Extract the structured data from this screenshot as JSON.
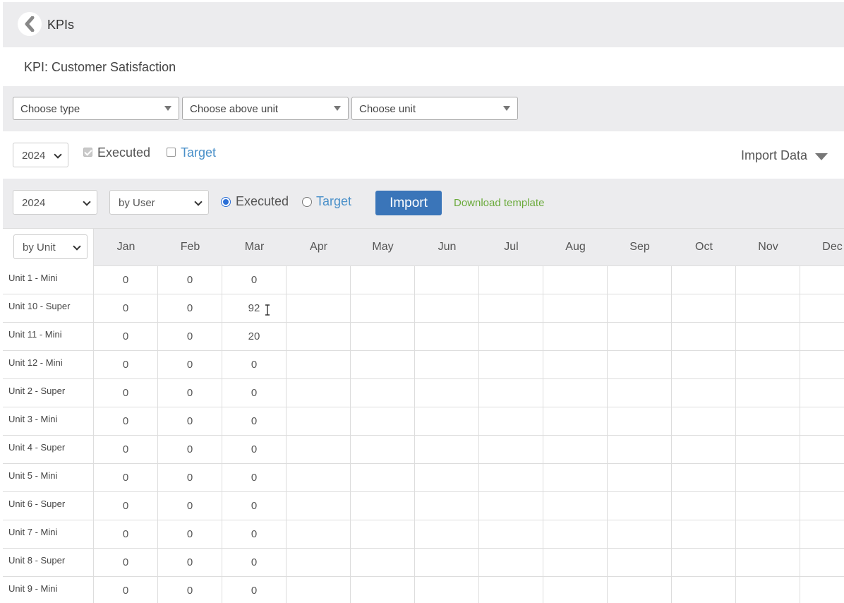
{
  "topbar": {
    "title": "KPIs"
  },
  "kpi": {
    "title": "KPI: Customer Satisfaction"
  },
  "filters": {
    "type": "Choose type",
    "above_unit": "Choose above unit",
    "unit": "Choose unit"
  },
  "view": {
    "year": "2024",
    "executed_label": "Executed",
    "executed_checked": true,
    "target_label": "Target",
    "target_checked": false,
    "import_data_label": "Import Data"
  },
  "import_bar": {
    "year": "2024",
    "by": "by User",
    "executed_label": "Executed",
    "target_label": "Target",
    "selected": "Executed",
    "import_button": "Import",
    "download_template": "Download template"
  },
  "grid": {
    "group_by": "by Unit",
    "months": [
      "Jan",
      "Feb",
      "Mar",
      "Apr",
      "May",
      "Jun",
      "Jul",
      "Aug",
      "Sep",
      "Oct",
      "Nov",
      "Dec"
    ],
    "rows": [
      {
        "unit": "Unit 1 - Mini",
        "values": [
          "0",
          "0",
          "0",
          "",
          "",
          "",
          "",
          "",
          "",
          "",
          "",
          ""
        ]
      },
      {
        "unit": "Unit 10 - Super",
        "values": [
          "0",
          "0",
          "92",
          "",
          "",
          "",
          "",
          "",
          "",
          "",
          "",
          ""
        ]
      },
      {
        "unit": "Unit 11 - Mini",
        "values": [
          "0",
          "0",
          "20",
          "",
          "",
          "",
          "",
          "",
          "",
          "",
          "",
          ""
        ]
      },
      {
        "unit": "Unit 12 - Mini",
        "values": [
          "0",
          "0",
          "0",
          "",
          "",
          "",
          "",
          "",
          "",
          "",
          "",
          ""
        ]
      },
      {
        "unit": "Unit 2 - Super",
        "values": [
          "0",
          "0",
          "0",
          "",
          "",
          "",
          "",
          "",
          "",
          "",
          "",
          ""
        ]
      },
      {
        "unit": "Unit 3 - Mini",
        "values": [
          "0",
          "0",
          "0",
          "",
          "",
          "",
          "",
          "",
          "",
          "",
          "",
          ""
        ]
      },
      {
        "unit": "Unit 4 - Super",
        "values": [
          "0",
          "0",
          "0",
          "",
          "",
          "",
          "",
          "",
          "",
          "",
          "",
          ""
        ]
      },
      {
        "unit": "Unit 5 - Mini",
        "values": [
          "0",
          "0",
          "0",
          "",
          "",
          "",
          "",
          "",
          "",
          "",
          "",
          ""
        ]
      },
      {
        "unit": "Unit 6 - Super",
        "values": [
          "0",
          "0",
          "0",
          "",
          "",
          "",
          "",
          "",
          "",
          "",
          "",
          ""
        ]
      },
      {
        "unit": "Unit 7 - Mini",
        "values": [
          "0",
          "0",
          "0",
          "",
          "",
          "",
          "",
          "",
          "",
          "",
          "",
          ""
        ]
      },
      {
        "unit": "Unit 8 - Super",
        "values": [
          "0",
          "0",
          "0",
          "",
          "",
          "",
          "",
          "",
          "",
          "",
          "",
          ""
        ]
      },
      {
        "unit": "Unit 9 - Mini",
        "values": [
          "0",
          "0",
          "0",
          "",
          "",
          "",
          "",
          "",
          "",
          "",
          "",
          ""
        ]
      }
    ]
  },
  "icons": {
    "back": "chevron-left-icon",
    "caret": "caret-down-icon",
    "text_cursor": "text-cursor-icon"
  },
  "colors": {
    "accent": "#3a75b9",
    "link": "#4a90c9",
    "download": "#6aaa3a",
    "radio": "#2b6fd6"
  }
}
